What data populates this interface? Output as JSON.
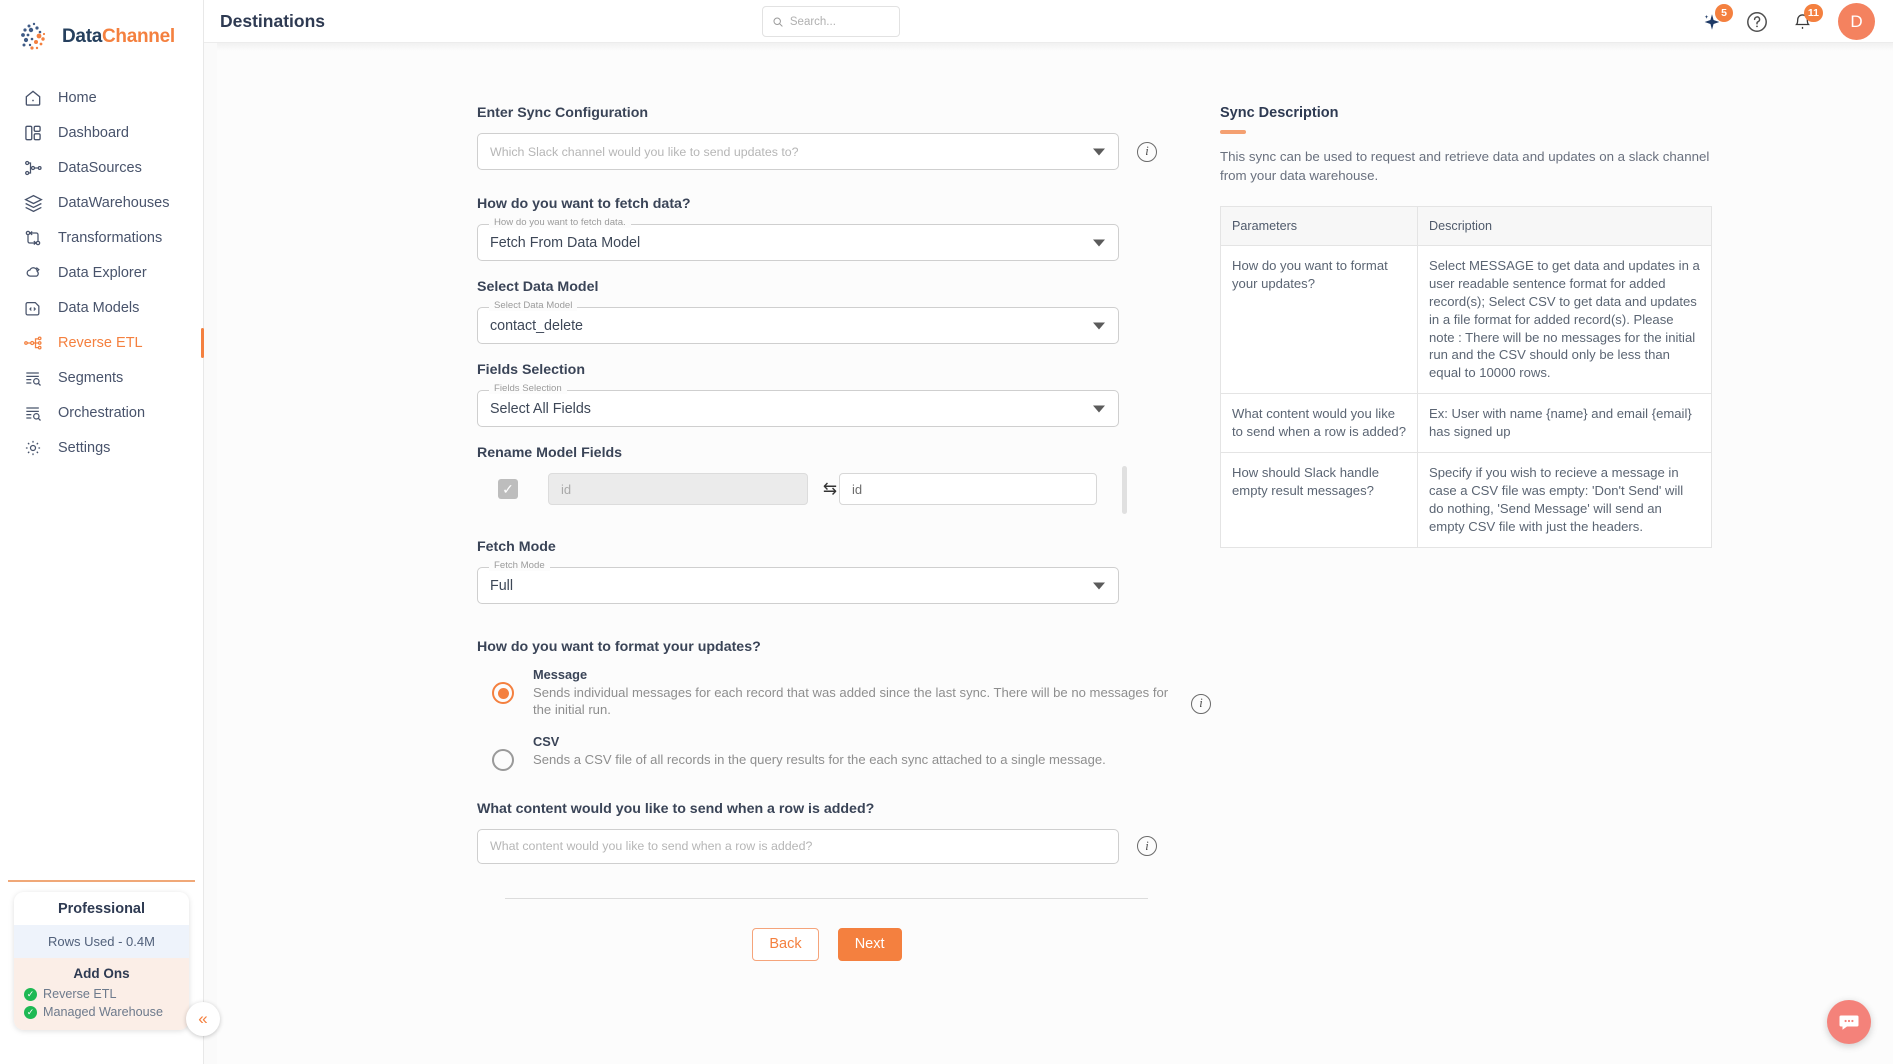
{
  "brand": {
    "name_part1": "Data",
    "name_part2": "Channel",
    "logo_icon": "datachannel-logo-icon"
  },
  "sidebar": {
    "items": [
      {
        "label": "Home",
        "icon": "home-icon",
        "active": false
      },
      {
        "label": "Dashboard",
        "icon": "dashboard-icon",
        "active": false
      },
      {
        "label": "DataSources",
        "icon": "datasources-icon",
        "active": false
      },
      {
        "label": "DataWarehouses",
        "icon": "datawarehouses-icon",
        "active": false
      },
      {
        "label": "Transformations",
        "icon": "transformations-icon",
        "active": false
      },
      {
        "label": "Data Explorer",
        "icon": "data-explorer-icon",
        "active": false
      },
      {
        "label": "Data Models",
        "icon": "data-models-icon",
        "active": false
      },
      {
        "label": "Reverse ETL",
        "icon": "reverse-etl-icon",
        "active": true
      },
      {
        "label": "Segments",
        "icon": "segments-icon",
        "active": false
      },
      {
        "label": "Orchestration",
        "icon": "orchestration-icon",
        "active": false
      },
      {
        "label": "Settings",
        "icon": "settings-gear-icon",
        "active": false
      }
    ],
    "plan": {
      "title": "Professional",
      "rows_used": "Rows Used - 0.4M",
      "addons_heading": "Add Ons",
      "addons": [
        "Reverse ETL",
        "Managed Warehouse"
      ]
    },
    "collapse_label": "«"
  },
  "topbar": {
    "title": "Destinations",
    "search_placeholder": "Search...",
    "ai_badge": "5",
    "notification_badge": "11",
    "avatar_initial": "D"
  },
  "form": {
    "sync_config_heading": "Enter Sync Configuration",
    "slack_channel_placeholder": "Which Slack channel would you like to send updates to?",
    "fetch_data_heading": "How do you want to fetch data?",
    "fetch_data_label": "How do you want to fetch data.",
    "fetch_data_value": "Fetch From Data Model",
    "data_model_heading": "Select Data Model",
    "data_model_label": "Select Data Model",
    "data_model_value": "contact_delete",
    "fields_selection_heading": "Fields Selection",
    "fields_selection_label": "Fields Selection",
    "fields_selection_value": "Select All Fields",
    "rename_heading": "Rename Model Fields",
    "rename_rows": [
      {
        "checked": true,
        "source_placeholder": "id",
        "target_value": "id"
      }
    ],
    "fetch_mode_heading": "Fetch Mode",
    "fetch_mode_label": "Fetch Mode",
    "fetch_mode_value": "Full",
    "format_heading": "How do you want to format your updates?",
    "format_options": [
      {
        "title": "Message",
        "desc": "Sends individual messages for each record that was added since the last sync. There will be no messages for the initial run.",
        "selected": true
      },
      {
        "title": "CSV",
        "desc": "Sends a CSV file of all records in the query results for the each sync attached to a single message.",
        "selected": false
      }
    ],
    "content_heading": "What content would you like to send when a row is added?",
    "content_placeholder": "What content would you like to send when a row is added?",
    "back_label": "Back",
    "next_label": "Next"
  },
  "description_panel": {
    "title": "Sync Description",
    "body": "This sync can be used to request and retrieve data and updates on a slack channel from your data warehouse.",
    "table": {
      "headers": [
        "Parameters",
        "Description"
      ],
      "rows": [
        [
          "How do you want to format your updates?",
          "Select MESSAGE to get data and updates in a user readable sentence format for added record(s); Select CSV to get data and updates in a file format for added record(s). Please note : There will be no messages for the initial run and the CSV should only be less than equal to 10000 rows."
        ],
        [
          "What content would you like to send when a row is added?",
          "Ex: User with name {name} and email {email} has signed up"
        ],
        [
          "How should Slack handle empty result messages?",
          "Specify if you wish to recieve a message in case a CSV file was empty: 'Don't Send' will do nothing, 'Send Message' will send an empty CSV file with just the headers."
        ]
      ]
    }
  },
  "chat": {
    "icon": "chat-bubble-icon"
  },
  "colors": {
    "accent": "#f4803f",
    "navy": "#26405e",
    "green": "#1eb954"
  }
}
